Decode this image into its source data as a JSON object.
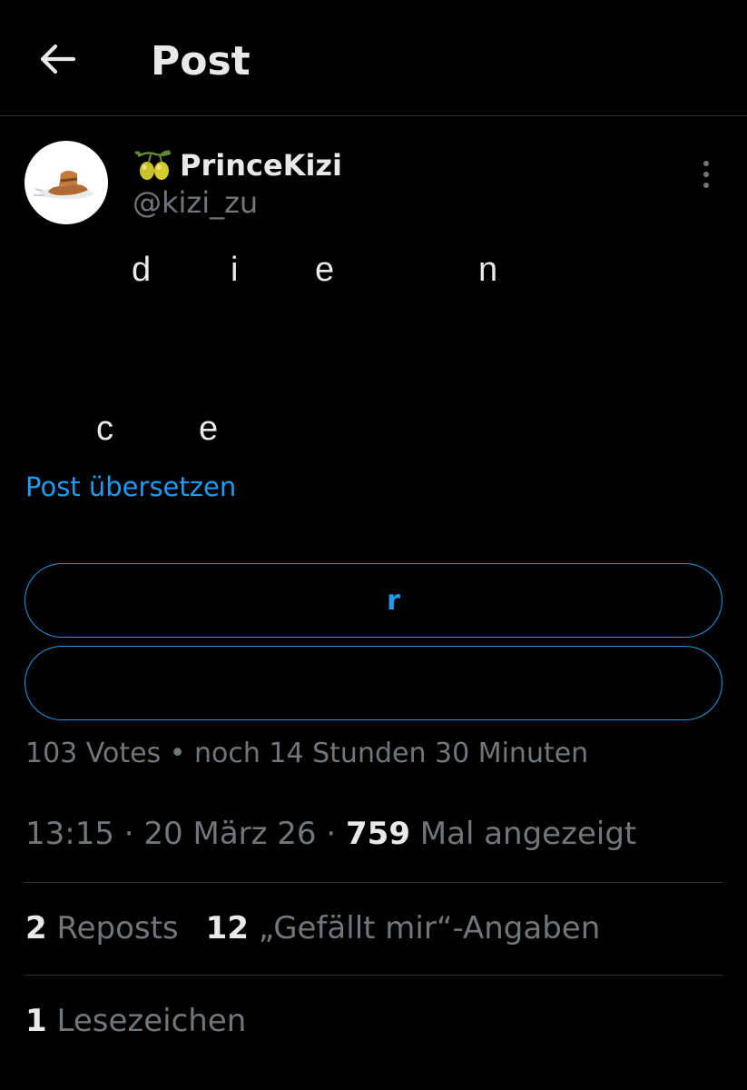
{
  "header": {
    "title": "Post",
    "back_icon": "arrow-left-icon"
  },
  "author": {
    "emoji_icon": "olive-icon",
    "name": "PrinceKizi",
    "handle": "@kizi_zu",
    "more_icon": "more-vertical-icon"
  },
  "post": {
    "fragments": [
      "d",
      "i",
      "e",
      "n",
      "c",
      "e"
    ],
    "translate_link": "Post übersetzen"
  },
  "poll": {
    "options": [
      {
        "label": "r"
      },
      {
        "label": ""
      }
    ],
    "votes": "103 Votes",
    "separator": "•",
    "remaining": "noch 14 Stunden 30 Minuten"
  },
  "meta": {
    "time": "13:15",
    "date": "20 März 26",
    "separator": "·",
    "views_count": "759",
    "views_label": "Mal angezeigt"
  },
  "stats": {
    "reposts_count": "2",
    "reposts_label": "Reposts",
    "likes_count": "12",
    "likes_label": "„Gefällt mir“-Angaben",
    "bookmarks_count": "1",
    "bookmarks_label": "Lesezeichen"
  },
  "colors": {
    "background": "#000000",
    "accent": "#1d9bf0",
    "primary_text": "#e7e9ea",
    "secondary_text": "#71767b",
    "divider": "#2f3336"
  }
}
